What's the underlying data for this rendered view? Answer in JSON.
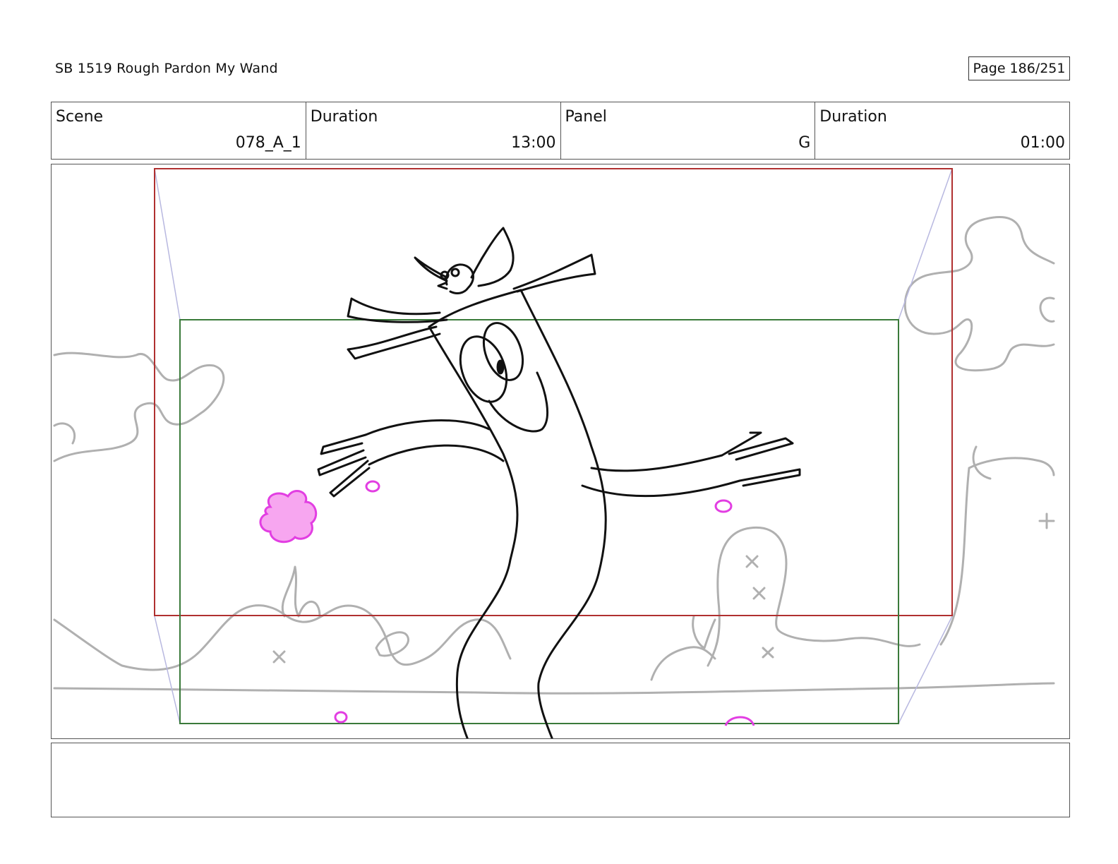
{
  "header": {
    "title": "SB 1519 Rough  Pardon My Wand",
    "page": "Page 186/251"
  },
  "info": {
    "scene_label": "Scene",
    "scene_value": "078_A_1",
    "duration_label": "Duration",
    "duration_value": "13:00",
    "panel_label": "Panel",
    "panel_value": "G",
    "panel_duration_label": "Duration",
    "panel_duration_value": "01:00"
  },
  "colors": {
    "red_frame": "#b03030",
    "green_frame": "#3a7a3a",
    "camera_lines": "#b8b8e0",
    "background_sketch": "#b0b0b0",
    "magenta": "#e23ee2"
  },
  "notes": ""
}
